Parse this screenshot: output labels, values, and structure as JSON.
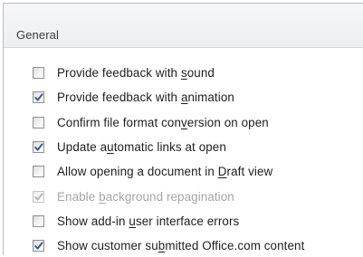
{
  "section": {
    "title": "General"
  },
  "options": [
    {
      "before": "Provide feedback with ",
      "key": "s",
      "after": "ound",
      "checked": false,
      "enabled": true
    },
    {
      "before": "Provide feedback with ",
      "key": "a",
      "after": "nimation",
      "checked": true,
      "enabled": true
    },
    {
      "before": "Confirm file format con",
      "key": "v",
      "after": "ersion on open",
      "checked": false,
      "enabled": true
    },
    {
      "before": "Update a",
      "key": "u",
      "after": "tomatic links at open",
      "checked": true,
      "enabled": true
    },
    {
      "before": "Allow opening a document in ",
      "key": "D",
      "after": "raft view",
      "checked": false,
      "enabled": true
    },
    {
      "before": "Enable ",
      "key": "b",
      "after": "ackground repagination",
      "checked": true,
      "enabled": false
    },
    {
      "before": "Show add-in ",
      "key": "u",
      "after": "ser interface errors",
      "checked": false,
      "enabled": true
    },
    {
      "before": "Show customer su",
      "key": "b",
      "after": "mitted Office.com content",
      "checked": true,
      "enabled": true
    }
  ],
  "colors": {
    "check_mark": "#3d5a8a",
    "check_mark_disabled": "#b5b5b5"
  },
  "icons": {
    "checkbox": "checkbox-icon",
    "check_mark": "check-mark-icon"
  }
}
